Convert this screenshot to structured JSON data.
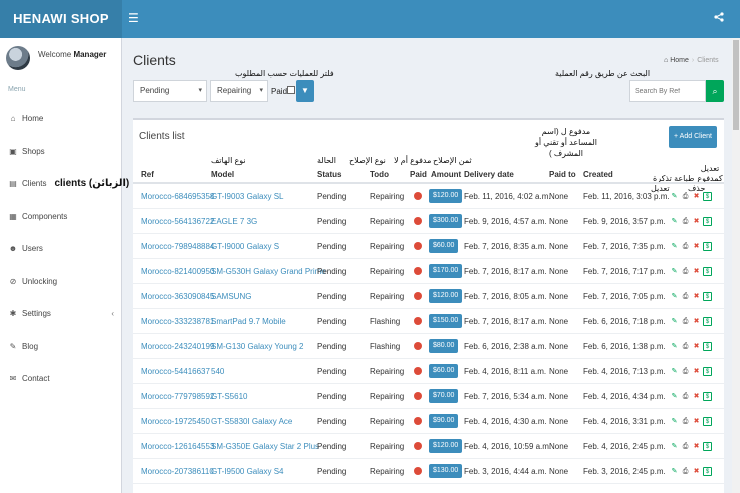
{
  "header": {
    "brand": "HENAWI SHOP",
    "menu_icon": "☰",
    "share_icon": "share-icon"
  },
  "sidebar": {
    "welcome": "Welcome",
    "user": "Manager",
    "menu_header": "Menu",
    "items": [
      {
        "label": "Home",
        "icon": "home-icon",
        "glyph": "⌂"
      },
      {
        "label": "Shops",
        "icon": "shop-icon",
        "glyph": "▣"
      },
      {
        "label": "Clients",
        "icon": "client-icon",
        "glyph": "▤",
        "extra": "clients (الزبائن)"
      },
      {
        "label": "Components",
        "icon": "components-icon",
        "glyph": "▦"
      },
      {
        "label": "Users",
        "icon": "users-icon",
        "glyph": "☻"
      },
      {
        "label": "Unlocking",
        "icon": "unlock-icon",
        "glyph": "⊘"
      },
      {
        "label": "Settings",
        "icon": "settings-icon",
        "glyph": "✱",
        "caret": "‹"
      },
      {
        "label": "Blog",
        "icon": "blog-icon",
        "glyph": "✎"
      },
      {
        "label": "Contact",
        "icon": "contact-icon",
        "glyph": "✉"
      }
    ]
  },
  "page": {
    "title": "Clients",
    "breadcrumb_home": "Home",
    "breadcrumb_current": "Clients",
    "filter_note": "فلتر للعمليات حسب المطلوب",
    "search_note": "البحث عن طريق رقم العملية"
  },
  "filters": {
    "status": "Pending",
    "todo": "Repairing",
    "paid_label": "Paid",
    "search_placeholder": "Search By Ref"
  },
  "box": {
    "title": "Clients list",
    "add_button": "Add Client",
    "columns": {
      "ref": "Ref",
      "model": "Model",
      "model_ar": "نوع الهاتف",
      "status": "Status",
      "status_ar": "الحالة",
      "todo": "Todo",
      "todo_ar": "نوع الإصلاح",
      "paid": "Paid",
      "paid_ar": "مدفوع أم لا",
      "amount": "Amount",
      "amount_ar": "ثمن الإصلاح",
      "delivery": "Delivery date",
      "paid_to": "Paid to",
      "paid_to_ar": "مدفوع ل (اسم المساعد أو تقني أو المشرف )",
      "created": "Created",
      "act_print_ar": "طباعة تذكرة",
      "act_edit_ar": "تعديل",
      "act_delete_ar": "حذف",
      "act_pay_ar": "تعديل كمدفوع"
    }
  },
  "rows": [
    {
      "ref": "Morocco-684695358",
      "model": "GT-I9003 Galaxy SL",
      "status": "Pending",
      "todo": "Repairing",
      "amount": "$120.00",
      "delivery": "Feb. 11, 2016, 4:02 a.m.",
      "paid_to": "None",
      "created": "Feb. 11, 2016, 3:03 p.m."
    },
    {
      "ref": "Morocco-564136722",
      "model": "EAGLE 7 3G",
      "status": "Pending",
      "todo": "Repairing",
      "amount": "$300.00",
      "delivery": "Feb. 9, 2016, 4:57 a.m.",
      "paid_to": "None",
      "created": "Feb. 9, 2016, 3:57 p.m."
    },
    {
      "ref": "Morocco-798948884",
      "model": "GT-I9000 Galaxy S",
      "status": "Pending",
      "todo": "Repairing",
      "amount": "$60.00",
      "delivery": "Feb. 7, 2016, 8:35 a.m.",
      "paid_to": "None",
      "created": "Feb. 7, 2016, 7:35 p.m."
    },
    {
      "ref": "Morocco-821400950",
      "model": "SM-G530H Galaxy Grand Prime",
      "status": "Pending",
      "todo": "Repairing",
      "amount": "$170.00",
      "delivery": "Feb. 7, 2016, 8:17 a.m.",
      "paid_to": "None",
      "created": "Feb. 7, 2016, 7:17 p.m."
    },
    {
      "ref": "Morocco-363090845",
      "model": "SAMSUNG",
      "status": "Pending",
      "todo": "Repairing",
      "amount": "$120.00",
      "delivery": "Feb. 7, 2016, 8:05 a.m.",
      "paid_to": "None",
      "created": "Feb. 7, 2016, 7:05 p.m."
    },
    {
      "ref": "Morocco-333238781",
      "model": "SmartPad 9.7 Mobile",
      "status": "Pending",
      "todo": "Flashing",
      "amount": "$150.00",
      "delivery": "Feb. 7, 2016, 8:17 a.m.",
      "paid_to": "None",
      "created": "Feb. 6, 2016, 7:18 p.m."
    },
    {
      "ref": "Morocco-243240199",
      "model": "SM-G130 Galaxy Young 2",
      "status": "Pending",
      "todo": "Flashing",
      "amount": "$80.00",
      "delivery": "Feb. 6, 2016, 2:38 a.m.",
      "paid_to": "None",
      "created": "Feb. 6, 2016, 1:38 p.m."
    },
    {
      "ref": "Morocco-54416637",
      "model": "540",
      "status": "Pending",
      "todo": "Repairing",
      "amount": "$60.00",
      "delivery": "Feb. 4, 2016, 8:11 a.m.",
      "paid_to": "None",
      "created": "Feb. 4, 2016, 7:13 p.m."
    },
    {
      "ref": "Morocco-779798592",
      "model": "GT-S5610",
      "status": "Pending",
      "todo": "Repairing",
      "amount": "$70.00",
      "delivery": "Feb. 7, 2016, 5:34 a.m.",
      "paid_to": "None",
      "created": "Feb. 4, 2016, 4:34 p.m."
    },
    {
      "ref": "Morocco-19725450",
      "model": "GT-S5830I Galaxy Ace",
      "status": "Pending",
      "todo": "Repairing",
      "amount": "$90.00",
      "delivery": "Feb. 4, 2016, 4:30 a.m.",
      "paid_to": "None",
      "created": "Feb. 4, 2016, 3:31 p.m."
    },
    {
      "ref": "Morocco-126164553",
      "model": "SM-G350E Galaxy Star 2 Plus",
      "status": "Pending",
      "todo": "Repairing",
      "amount": "$120.00",
      "delivery": "Feb. 4, 2016, 10:59 a.m.",
      "paid_to": "None",
      "created": "Feb. 4, 2016, 2:45 p.m."
    },
    {
      "ref": "Morocco-207386110",
      "model": "GT-I9500 Galaxy S4",
      "status": "Pending",
      "todo": "Repairing",
      "amount": "$130.00",
      "delivery": "Feb. 3, 2016, 4:44 a.m.",
      "paid_to": "None",
      "created": "Feb. 3, 2016, 2:45 p.m."
    }
  ],
  "colors": {
    "brand": "#367fa9",
    "header": "#3c8dbc",
    "paid_dot": "#dd4b39",
    "success": "#00a65a"
  }
}
